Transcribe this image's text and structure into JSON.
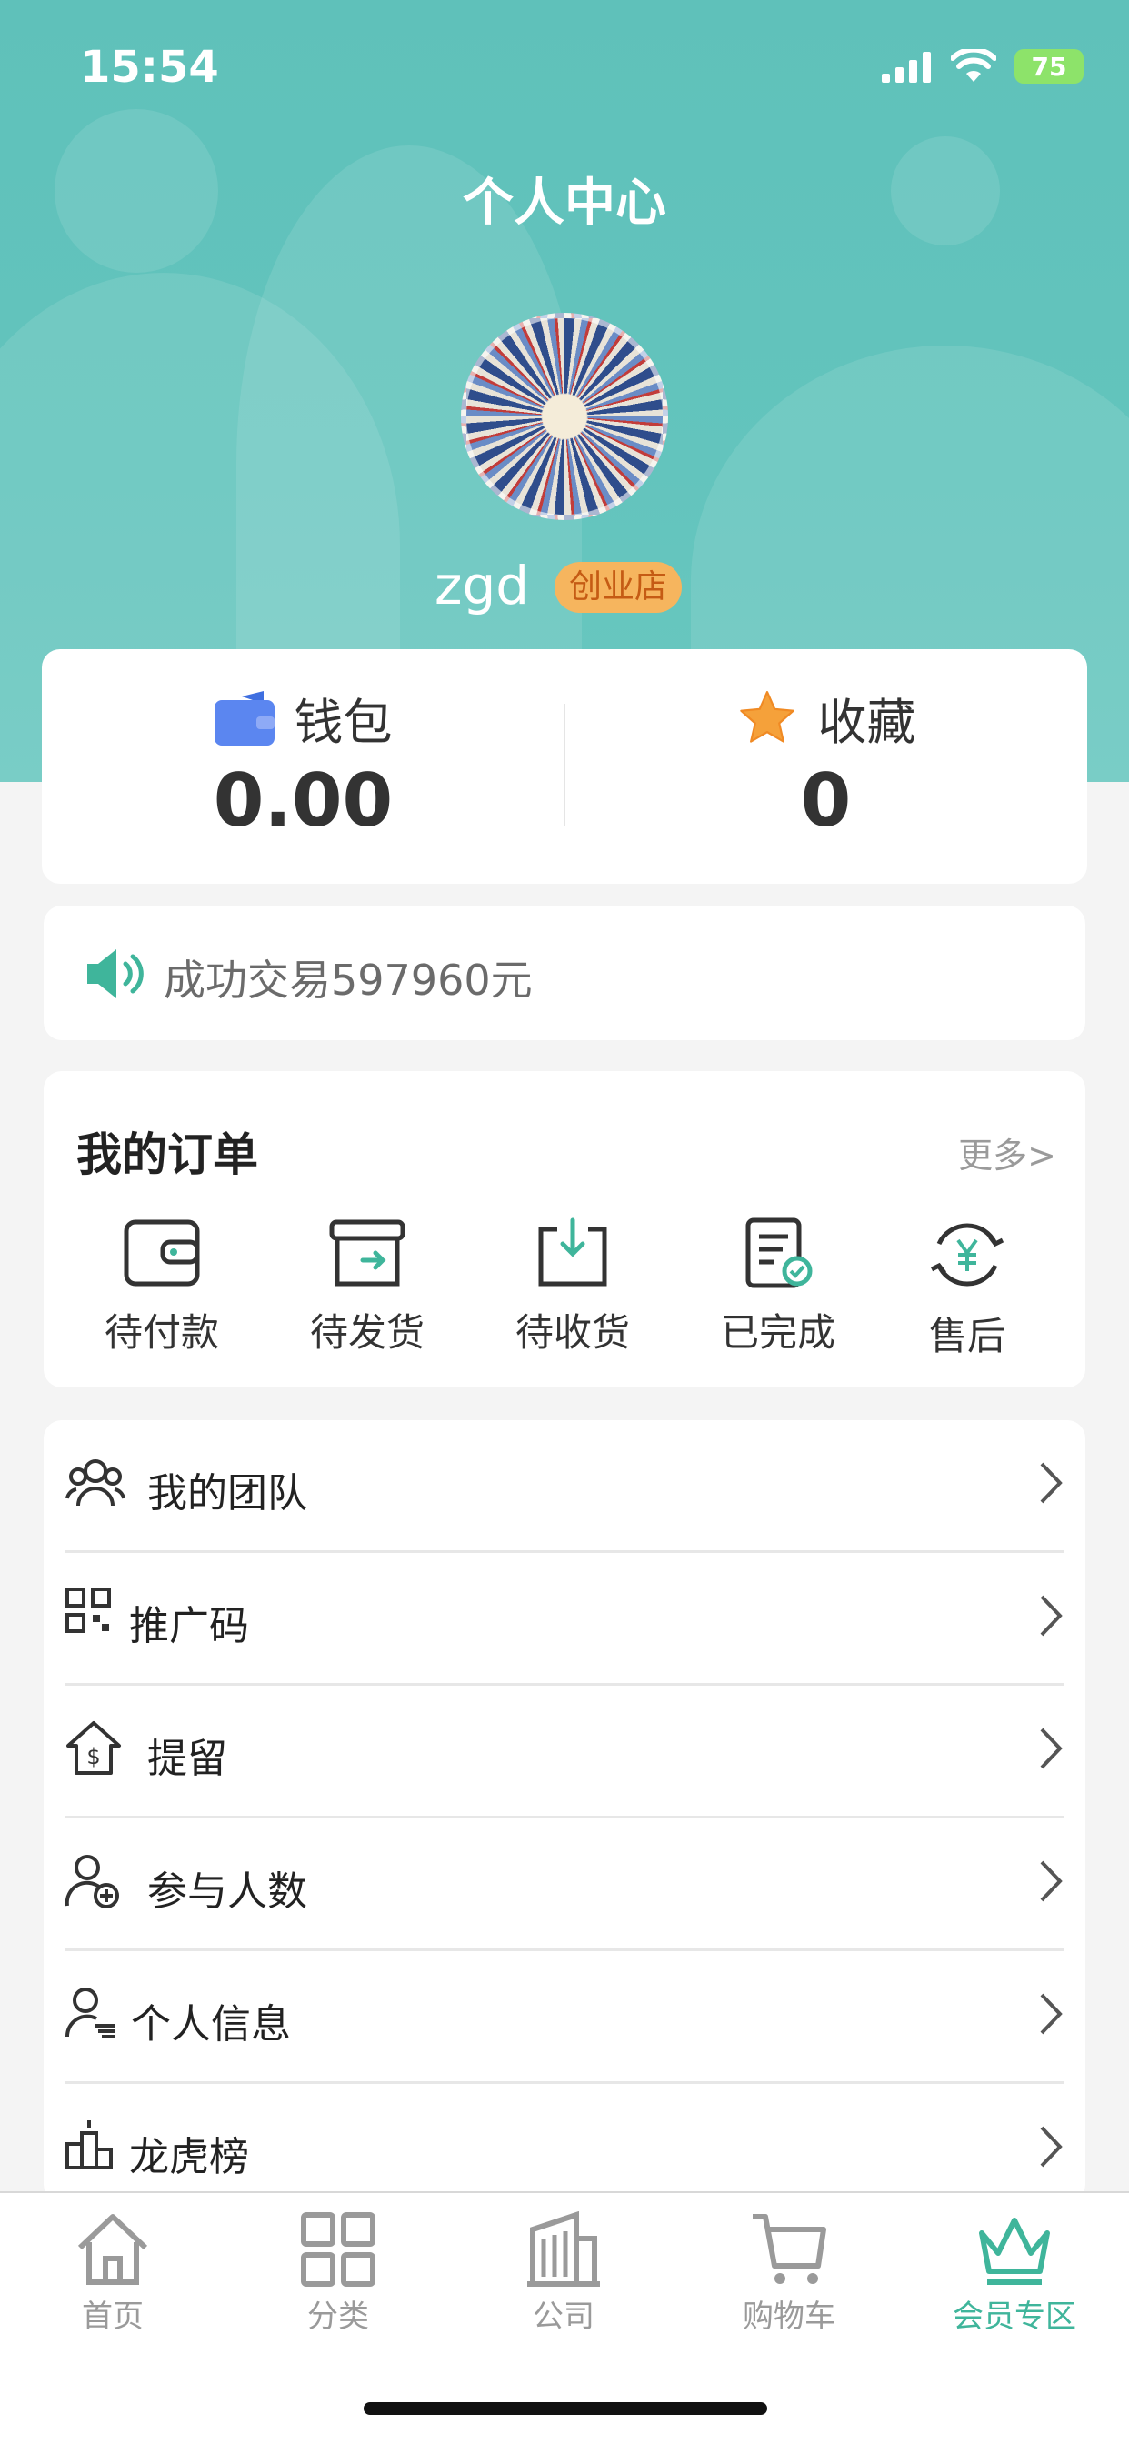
{
  "status_bar": {
    "time": "15:54",
    "battery": "75"
  },
  "page_title": "个人中心",
  "profile": {
    "username": "zgd",
    "badge": "创业店"
  },
  "wallet": {
    "label": "钱包",
    "value": "0.00"
  },
  "favorites": {
    "label": "收藏",
    "value": "0"
  },
  "notice": {
    "text": "成功交易597960元"
  },
  "orders": {
    "title": "我的订单",
    "more": "更多>",
    "items": [
      {
        "label": "待付款",
        "icon": "wallet-icon"
      },
      {
        "label": "待发货",
        "icon": "ship-box-icon"
      },
      {
        "label": "待收货",
        "icon": "receive-icon"
      },
      {
        "label": "已完成",
        "icon": "completed-doc-icon"
      },
      {
        "label": "售后",
        "icon": "refund-yen-icon"
      }
    ]
  },
  "menu": [
    {
      "label": "我的团队",
      "icon": "team-icon"
    },
    {
      "label": "推广码",
      "icon": "qr-code-icon"
    },
    {
      "label": "提留",
      "icon": "dollar-house-icon"
    },
    {
      "label": "参与人数",
      "icon": "add-person-icon"
    },
    {
      "label": "个人信息",
      "icon": "person-info-icon"
    },
    {
      "label": "龙虎榜",
      "icon": "ranking-icon"
    }
  ],
  "tabbar": [
    {
      "label": "首页",
      "icon": "home-icon"
    },
    {
      "label": "分类",
      "icon": "grid-icon"
    },
    {
      "label": "公司",
      "icon": "building-icon"
    },
    {
      "label": "购物车",
      "icon": "cart-icon"
    },
    {
      "label": "会员专区",
      "icon": "crown-icon",
      "active": true
    }
  ],
  "colors": {
    "header": "#5fc1ba",
    "accent": "#3fb59b",
    "badge": "#f6b55e"
  }
}
